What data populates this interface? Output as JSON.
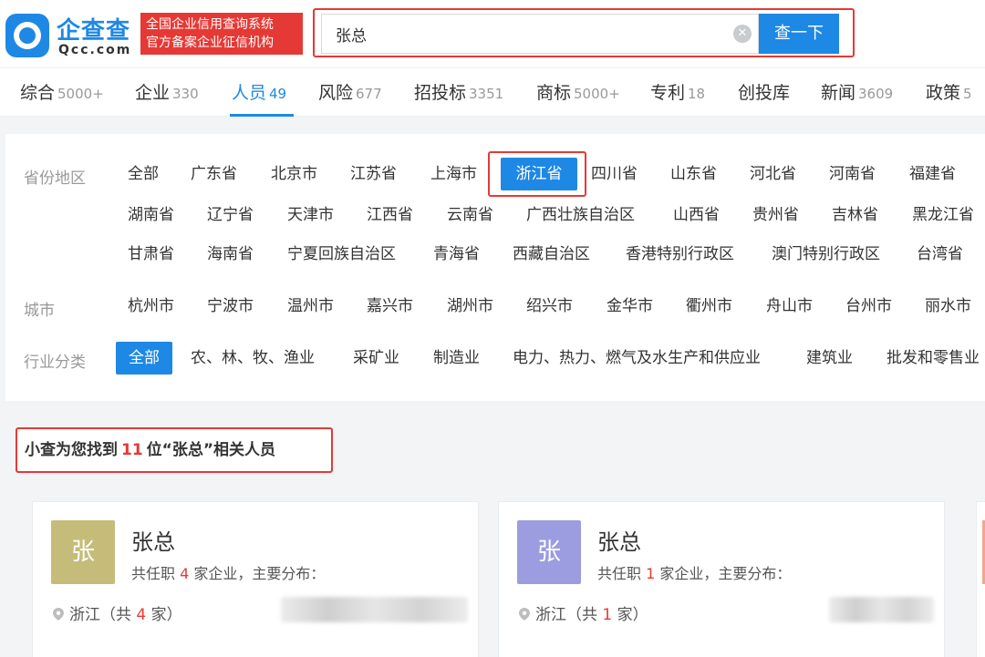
{
  "brand": {
    "name": "企查查",
    "domain": "Qcc.com",
    "slogan_line1": "全国企业信用查询系统",
    "slogan_line2": "官方备案企业征信机构"
  },
  "search": {
    "value": "张总",
    "button_label": "查一下"
  },
  "tabs": [
    {
      "label": "综合",
      "count": "5000+"
    },
    {
      "label": "企业",
      "count": "330"
    },
    {
      "label": "人员",
      "count": "49",
      "active": true
    },
    {
      "label": "风险",
      "count": "677"
    },
    {
      "label": "招投标",
      "count": "3351"
    },
    {
      "label": "商标",
      "count": "5000+"
    },
    {
      "label": "专利",
      "count": "18"
    },
    {
      "label": "创投库",
      "count": ""
    },
    {
      "label": "新闻",
      "count": "3609"
    },
    {
      "label": "政策",
      "count": "5"
    }
  ],
  "filters": {
    "province_label": "省份地区",
    "provinces": [
      "全部",
      "广东省",
      "北京市",
      "江苏省",
      "上海市",
      "浙江省",
      "四川省",
      "山东省",
      "河北省",
      "河南省",
      "福建省",
      "湖南省",
      "辽宁省",
      "天津市",
      "江西省",
      "云南省",
      "广西壮族自治区",
      "山西省",
      "贵州省",
      "吉林省",
      "黑龙江省",
      "甘肃省",
      "海南省",
      "宁夏回族自治区",
      "青海省",
      "西藏自治区",
      "香港特别行政区",
      "澳门特别行政区",
      "台湾省"
    ],
    "province_selected": "浙江省",
    "city_label": "城市",
    "cities": [
      "杭州市",
      "宁波市",
      "温州市",
      "嘉兴市",
      "湖州市",
      "绍兴市",
      "金华市",
      "衢州市",
      "舟山市",
      "台州市",
      "丽水市"
    ],
    "industry_label": "行业分类",
    "industries": [
      "全部",
      "农、林、牧、渔业",
      "采矿业",
      "制造业",
      "电力、热力、燃气及水生产和供应业",
      "建筑业",
      "批发和零售业"
    ],
    "industry_selected": "全部"
  },
  "results": {
    "prefix": "小查为您找到",
    "count": "11",
    "suffix": "位“张总”相关人员",
    "cards": [
      {
        "avatar_char": "张",
        "avatar_color": "#c5bc7a",
        "name": "张总",
        "pos_prefix": "共任职",
        "pos_count": "4",
        "pos_suffix": "家企业，主要分布：",
        "loc_prefix": "浙江（共",
        "loc_count": "4",
        "loc_suffix": "家）"
      },
      {
        "avatar_char": "张",
        "avatar_color": "#9b9de0",
        "name": "张总",
        "pos_prefix": "共任职",
        "pos_count": "1",
        "pos_suffix": "家企业，主要分布：",
        "loc_prefix": "浙江（共",
        "loc_count": "1",
        "loc_suffix": "家）"
      }
    ]
  },
  "colors": {
    "accent": "#1e88e5",
    "highlight": "#e53935"
  }
}
